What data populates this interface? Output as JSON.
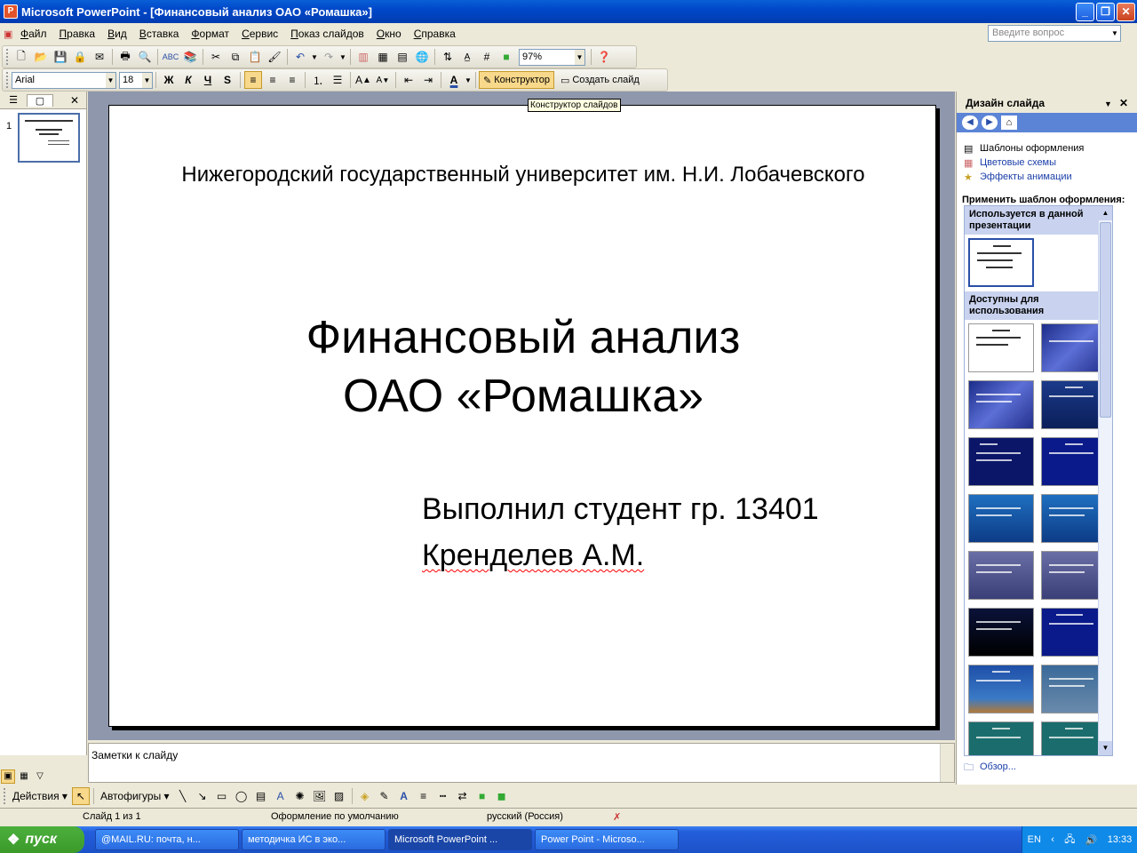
{
  "window": {
    "title": "Microsoft PowerPoint - [Финансовый анализ ОАО «Ромашка»]"
  },
  "menu": [
    "Файл",
    "Правка",
    "Вид",
    "Вставка",
    "Формат",
    "Сервис",
    "Показ слайдов",
    "Окно",
    "Справка"
  ],
  "help_placeholder": "Введите вопрос",
  "toolbar": {
    "zoom": "97%",
    "font": "Arial",
    "font_size": "18",
    "designer_label": "Конструктор",
    "new_slide_label": "Создать слайд",
    "tooltip": "Конструктор слайдов"
  },
  "slides_panel": {
    "slide_number": "1"
  },
  "slide": {
    "university": "Нижегородский государственный университет им. Н.И. Лобачевского",
    "title_line1": "Финансовый анализ",
    "title_line2": "ОАО «Ромашка»",
    "author_line1": "Выполнил студент гр. 13401",
    "author_line2": "Кренделев А.М."
  },
  "notes_placeholder": "Заметки к слайду",
  "taskpane": {
    "title": "Дизайн слайда",
    "links": [
      "Шаблоны оформления",
      "Цветовые схемы",
      "Эффекты анимации"
    ],
    "apply_label": "Применить шаблон оформления:",
    "section_used": "Используется в данной презентации",
    "section_available": "Доступны для использования",
    "browse": "Обзор..."
  },
  "drawing": {
    "actions": "Действия",
    "autoshapes": "Автофигуры"
  },
  "status": {
    "slide": "Слайд 1 из 1",
    "design": "Оформление по умолчанию",
    "language": "русский (Россия)"
  },
  "taskbar": {
    "start": "пуск",
    "tasks": [
      "@MAIL.RU: почта, н...",
      "методичка ИС в эко...",
      "Microsoft PowerPoint ...",
      "Power Point - Microso..."
    ],
    "lang": "EN",
    "clock": "13:33"
  }
}
